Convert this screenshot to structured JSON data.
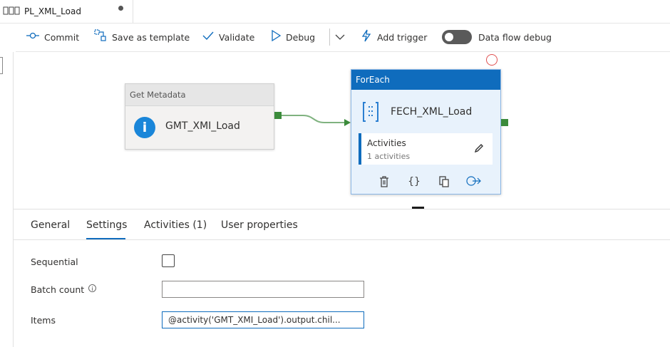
{
  "tab": {
    "icon": "pipeline-icon",
    "title": "PL_XML_Load"
  },
  "toolbar": {
    "commit": "Commit",
    "save_template": "Save as template",
    "validate": "Validate",
    "debug": "Debug",
    "add_trigger": "Add trigger",
    "dataflow_debug": "Data flow debug",
    "dataflow_debug_on": false
  },
  "canvas": {
    "get_metadata": {
      "type_label": "Get Metadata",
      "name": "GMT_XMI_Load"
    },
    "foreach": {
      "type_label": "ForEach",
      "name": "FECH_XML_Load",
      "activities_title": "Activities",
      "activities_count": "1 activities"
    }
  },
  "properties": {
    "tabs": [
      "General",
      "Settings",
      "Activities (1)",
      "User properties"
    ],
    "active_tab": "Settings",
    "sequential_label": "Sequential",
    "sequential_checked": false,
    "batch_count_label": "Batch count",
    "batch_count_value": "",
    "items_label": "Items",
    "items_value": "@activity('GMT_XMI_Load').output.chil..."
  },
  "colors": {
    "accent": "#0f6cbd",
    "success_port": "#3b8b3b",
    "info_icon": "#1a86d9"
  }
}
